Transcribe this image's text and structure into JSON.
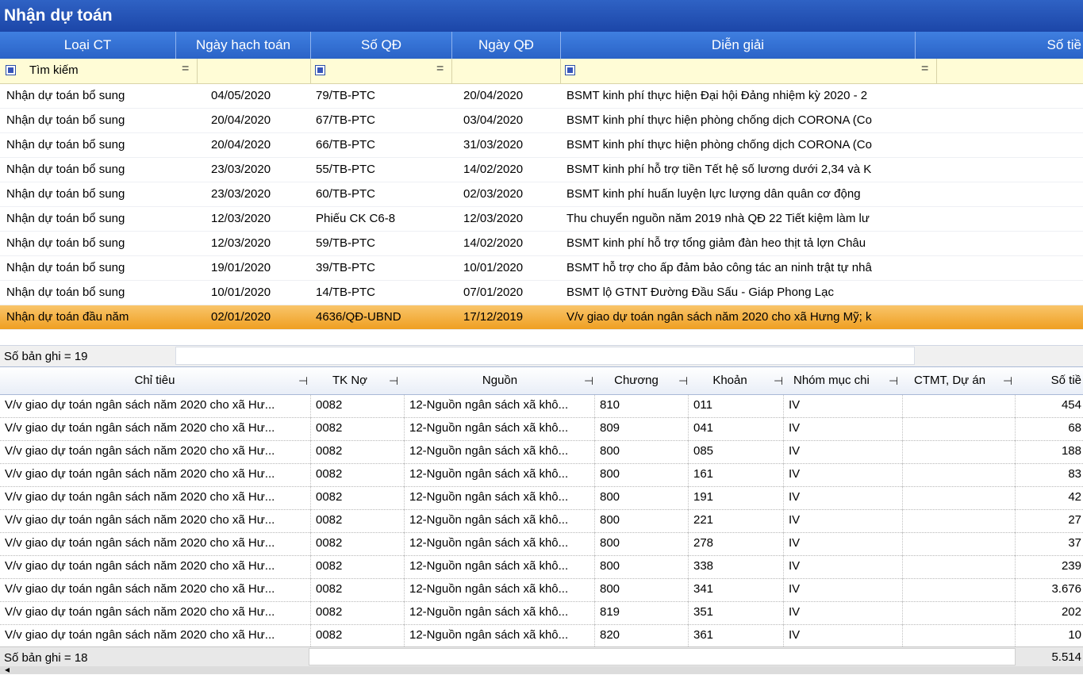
{
  "window_title": "Nhận dự toán",
  "grid1": {
    "headers": [
      "Loại CT",
      "Ngày hạch toán",
      "Số QĐ",
      "Ngày QĐ",
      "Diễn giải",
      "Số tiề"
    ],
    "filter_label": "Tìm kiếm",
    "rows": [
      {
        "loai": "Nhận dự toán bổ sung",
        "ngay_ht": "04/05/2020",
        "so_qd": "79/TB-PTC",
        "ngay_qd": "20/04/2020",
        "dien_giai": "BSMT kinh phí thực hiện Đại hội Đảng nhiệm kỳ 2020 - 2"
      },
      {
        "loai": "Nhận dự toán bổ sung",
        "ngay_ht": "20/04/2020",
        "so_qd": "67/TB-PTC",
        "ngay_qd": "03/04/2020",
        "dien_giai": "BSMT kinh phí thực hiện phòng chống dịch CORONA (Co"
      },
      {
        "loai": "Nhận dự toán bổ sung",
        "ngay_ht": "20/04/2020",
        "so_qd": "66/TB-PTC",
        "ngay_qd": "31/03/2020",
        "dien_giai": "BSMT kinh phí thực hiện phòng chống dịch CORONA (Co"
      },
      {
        "loai": "Nhận dự toán bổ sung",
        "ngay_ht": "23/03/2020",
        "so_qd": "55/TB-PTC",
        "ngay_qd": "14/02/2020",
        "dien_giai": "BSMT kinh phí hỗ trợ tiền Tết hệ số lương dưới 2,34 và K"
      },
      {
        "loai": "Nhận dự toán bổ sung",
        "ngay_ht": "23/03/2020",
        "so_qd": "60/TB-PTC",
        "ngay_qd": "02/03/2020",
        "dien_giai": "BSMT kinh phí huấn luyện lực lượng dân quân cơ động"
      },
      {
        "loai": "Nhận dự toán bổ sung",
        "ngay_ht": "12/03/2020",
        "so_qd": "Phiếu CK C6-8",
        "ngay_qd": "12/03/2020",
        "dien_giai": "Thu chuyển nguồn năm 2019 nhà QĐ 22 Tiết kiệm làm lư"
      },
      {
        "loai": "Nhận dự toán bổ sung",
        "ngay_ht": "12/03/2020",
        "so_qd": "59/TB-PTC",
        "ngay_qd": "14/02/2020",
        "dien_giai": "BSMT kinh phí hỗ trợ tổng giảm đàn heo thịt tả lợn Châu"
      },
      {
        "loai": "Nhận dự toán bổ sung",
        "ngay_ht": "19/01/2020",
        "so_qd": "39/TB-PTC",
        "ngay_qd": "10/01/2020",
        "dien_giai": "BSMT hỗ trợ cho ấp đảm bảo công tác an ninh trật tự nhâ"
      },
      {
        "loai": "Nhận dự toán bổ sung",
        "ngay_ht": "10/01/2020",
        "so_qd": "14/TB-PTC",
        "ngay_qd": "07/01/2020",
        "dien_giai": "BSMT lộ GTNT Đường Đầu Sấu - Giáp Phong Lạc"
      },
      {
        "loai": "Nhận dự toán đầu năm",
        "ngay_ht": "02/01/2020",
        "so_qd": "4636/QĐ-UBND",
        "ngay_qd": "17/12/2019",
        "dien_giai": "V/v giao dự toán ngân sách năm 2020 cho xã Hưng Mỹ; k"
      }
    ],
    "selected_index": 9,
    "record_count": "Số bản ghi = 19"
  },
  "grid2": {
    "headers": [
      "Chỉ tiêu",
      "TK Nợ",
      "Nguồn",
      "Chương",
      "Khoản",
      "Nhóm mục chi",
      "CTMT, Dự án",
      "Số tiề"
    ],
    "rows": [
      {
        "chi_tieu": "V/v giao dự toán ngân sách năm 2020 cho xã Hư...",
        "tk_no": "0082",
        "nguon": "12-Nguồn ngân sách xã khô...",
        "chuong": "810",
        "khoan": "011",
        "nhom": "IV",
        "ctmt": "",
        "so_tien": "454"
      },
      {
        "chi_tieu": "V/v giao dự toán ngân sách năm 2020 cho xã Hư...",
        "tk_no": "0082",
        "nguon": "12-Nguồn ngân sách xã khô...",
        "chuong": "809",
        "khoan": "041",
        "nhom": "IV",
        "ctmt": "",
        "so_tien": "68"
      },
      {
        "chi_tieu": "V/v giao dự toán ngân sách năm 2020 cho xã Hư...",
        "tk_no": "0082",
        "nguon": "12-Nguồn ngân sách xã khô...",
        "chuong": "800",
        "khoan": "085",
        "nhom": "IV",
        "ctmt": "",
        "so_tien": "188"
      },
      {
        "chi_tieu": "V/v giao dự toán ngân sách năm 2020 cho xã Hư...",
        "tk_no": "0082",
        "nguon": "12-Nguồn ngân sách xã khô...",
        "chuong": "800",
        "khoan": "161",
        "nhom": "IV",
        "ctmt": "",
        "so_tien": "83"
      },
      {
        "chi_tieu": "V/v giao dự toán ngân sách năm 2020 cho xã Hư...",
        "tk_no": "0082",
        "nguon": "12-Nguồn ngân sách xã khô...",
        "chuong": "800",
        "khoan": "191",
        "nhom": "IV",
        "ctmt": "",
        "so_tien": "42"
      },
      {
        "chi_tieu": "V/v giao dự toán ngân sách năm 2020 cho xã Hư...",
        "tk_no": "0082",
        "nguon": "12-Nguồn ngân sách xã khô...",
        "chuong": "800",
        "khoan": "221",
        "nhom": "IV",
        "ctmt": "",
        "so_tien": "27"
      },
      {
        "chi_tieu": "V/v giao dự toán ngân sách năm 2020 cho xã Hư...",
        "tk_no": "0082",
        "nguon": "12-Nguồn ngân sách xã khô...",
        "chuong": "800",
        "khoan": "278",
        "nhom": "IV",
        "ctmt": "",
        "so_tien": "37"
      },
      {
        "chi_tieu": "V/v giao dự toán ngân sách năm 2020 cho xã Hư...",
        "tk_no": "0082",
        "nguon": "12-Nguồn ngân sách xã khô...",
        "chuong": "800",
        "khoan": "338",
        "nhom": "IV",
        "ctmt": "",
        "so_tien": "239"
      },
      {
        "chi_tieu": "V/v giao dự toán ngân sách năm 2020 cho xã Hư...",
        "tk_no": "0082",
        "nguon": "12-Nguồn ngân sách xã khô...",
        "chuong": "800",
        "khoan": "341",
        "nhom": "IV",
        "ctmt": "",
        "so_tien": "3.676"
      },
      {
        "chi_tieu": "V/v giao dự toán ngân sách năm 2020 cho xã Hư...",
        "tk_no": "0082",
        "nguon": "12-Nguồn ngân sách xã khô...",
        "chuong": "819",
        "khoan": "351",
        "nhom": "IV",
        "ctmt": "",
        "so_tien": "202"
      },
      {
        "chi_tieu": "V/v giao dự toán ngân sách năm 2020 cho xã Hư...",
        "tk_no": "0082",
        "nguon": "12-Nguồn ngân sách xã khô...",
        "chuong": "820",
        "khoan": "361",
        "nhom": "IV",
        "ctmt": "",
        "so_tien": "10"
      }
    ],
    "record_count": "Số bản ghi = 18",
    "total": "5.514"
  },
  "colors": {
    "title_bar": "#1c46a8",
    "header": "#2a63c7",
    "filter_bg": "#fffcd6",
    "selected_row": "#ef9f22"
  }
}
